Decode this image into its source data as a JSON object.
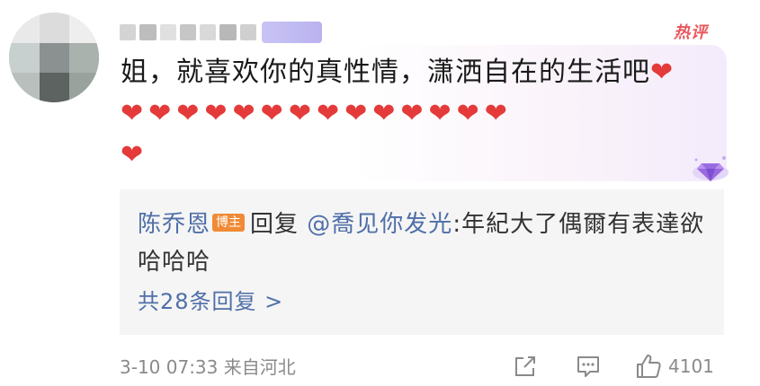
{
  "comment": {
    "hot_badge": "热评",
    "text": "姐，就喜欢你的真性情，潇洒自在的生活吧",
    "heart_first": "❤",
    "hearts_row2": "❤❤❤❤❤❤❤❤❤❤❤❤❤❤",
    "heart_last": "❤"
  },
  "reply": {
    "author": "陈乔恩",
    "author_badge": "博主",
    "verb": "回复",
    "mention": "@喬见你发光",
    "text": ":年紀大了偶爾有表達欲哈哈哈",
    "more_label": "共28条回复 >"
  },
  "footer": {
    "timestamp": "3-10 07:33",
    "location": "来自河北",
    "like_count": "4101"
  },
  "colors": {
    "link_blue": "#4f6fa8",
    "hot_red": "#e8585d",
    "heart_red": "#e43a3a",
    "badge_orange": "#f08a36"
  }
}
